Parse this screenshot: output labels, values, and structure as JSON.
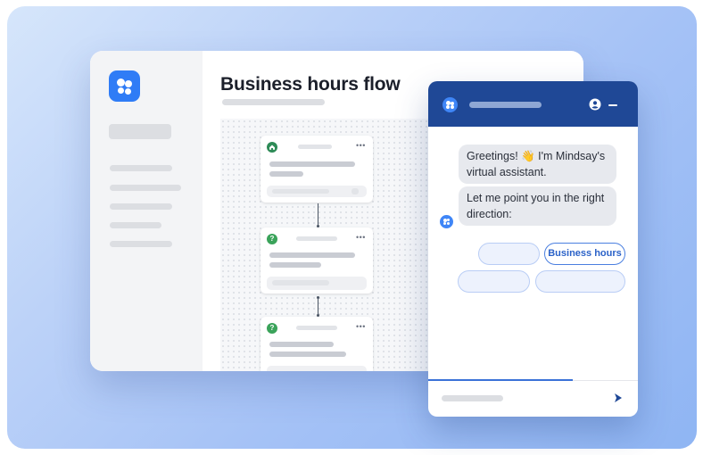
{
  "flow_editor": {
    "title": "Business hours flow"
  },
  "chat": {
    "messages": [
      "Greetings! 👋 I'm Mindsay's virtual assistant.",
      "Let me point you in the right direction:"
    ],
    "quick_replies": [
      {
        "label": ""
      },
      {
        "label": "Business hours"
      },
      {
        "label": ""
      },
      {
        "label": ""
      }
    ]
  },
  "colors": {
    "brand_blue": "#2f7cf6",
    "header_navy": "#1f4896",
    "start_node_green": "#2e8b57",
    "question_node_green": "#3aa35a"
  },
  "icons": {
    "app_logo": "mindsay-logo-icon",
    "start_node": "home-icon",
    "question_node": "question-icon",
    "user": "user-icon",
    "minimize": "minimize-icon",
    "send": "send-icon"
  }
}
